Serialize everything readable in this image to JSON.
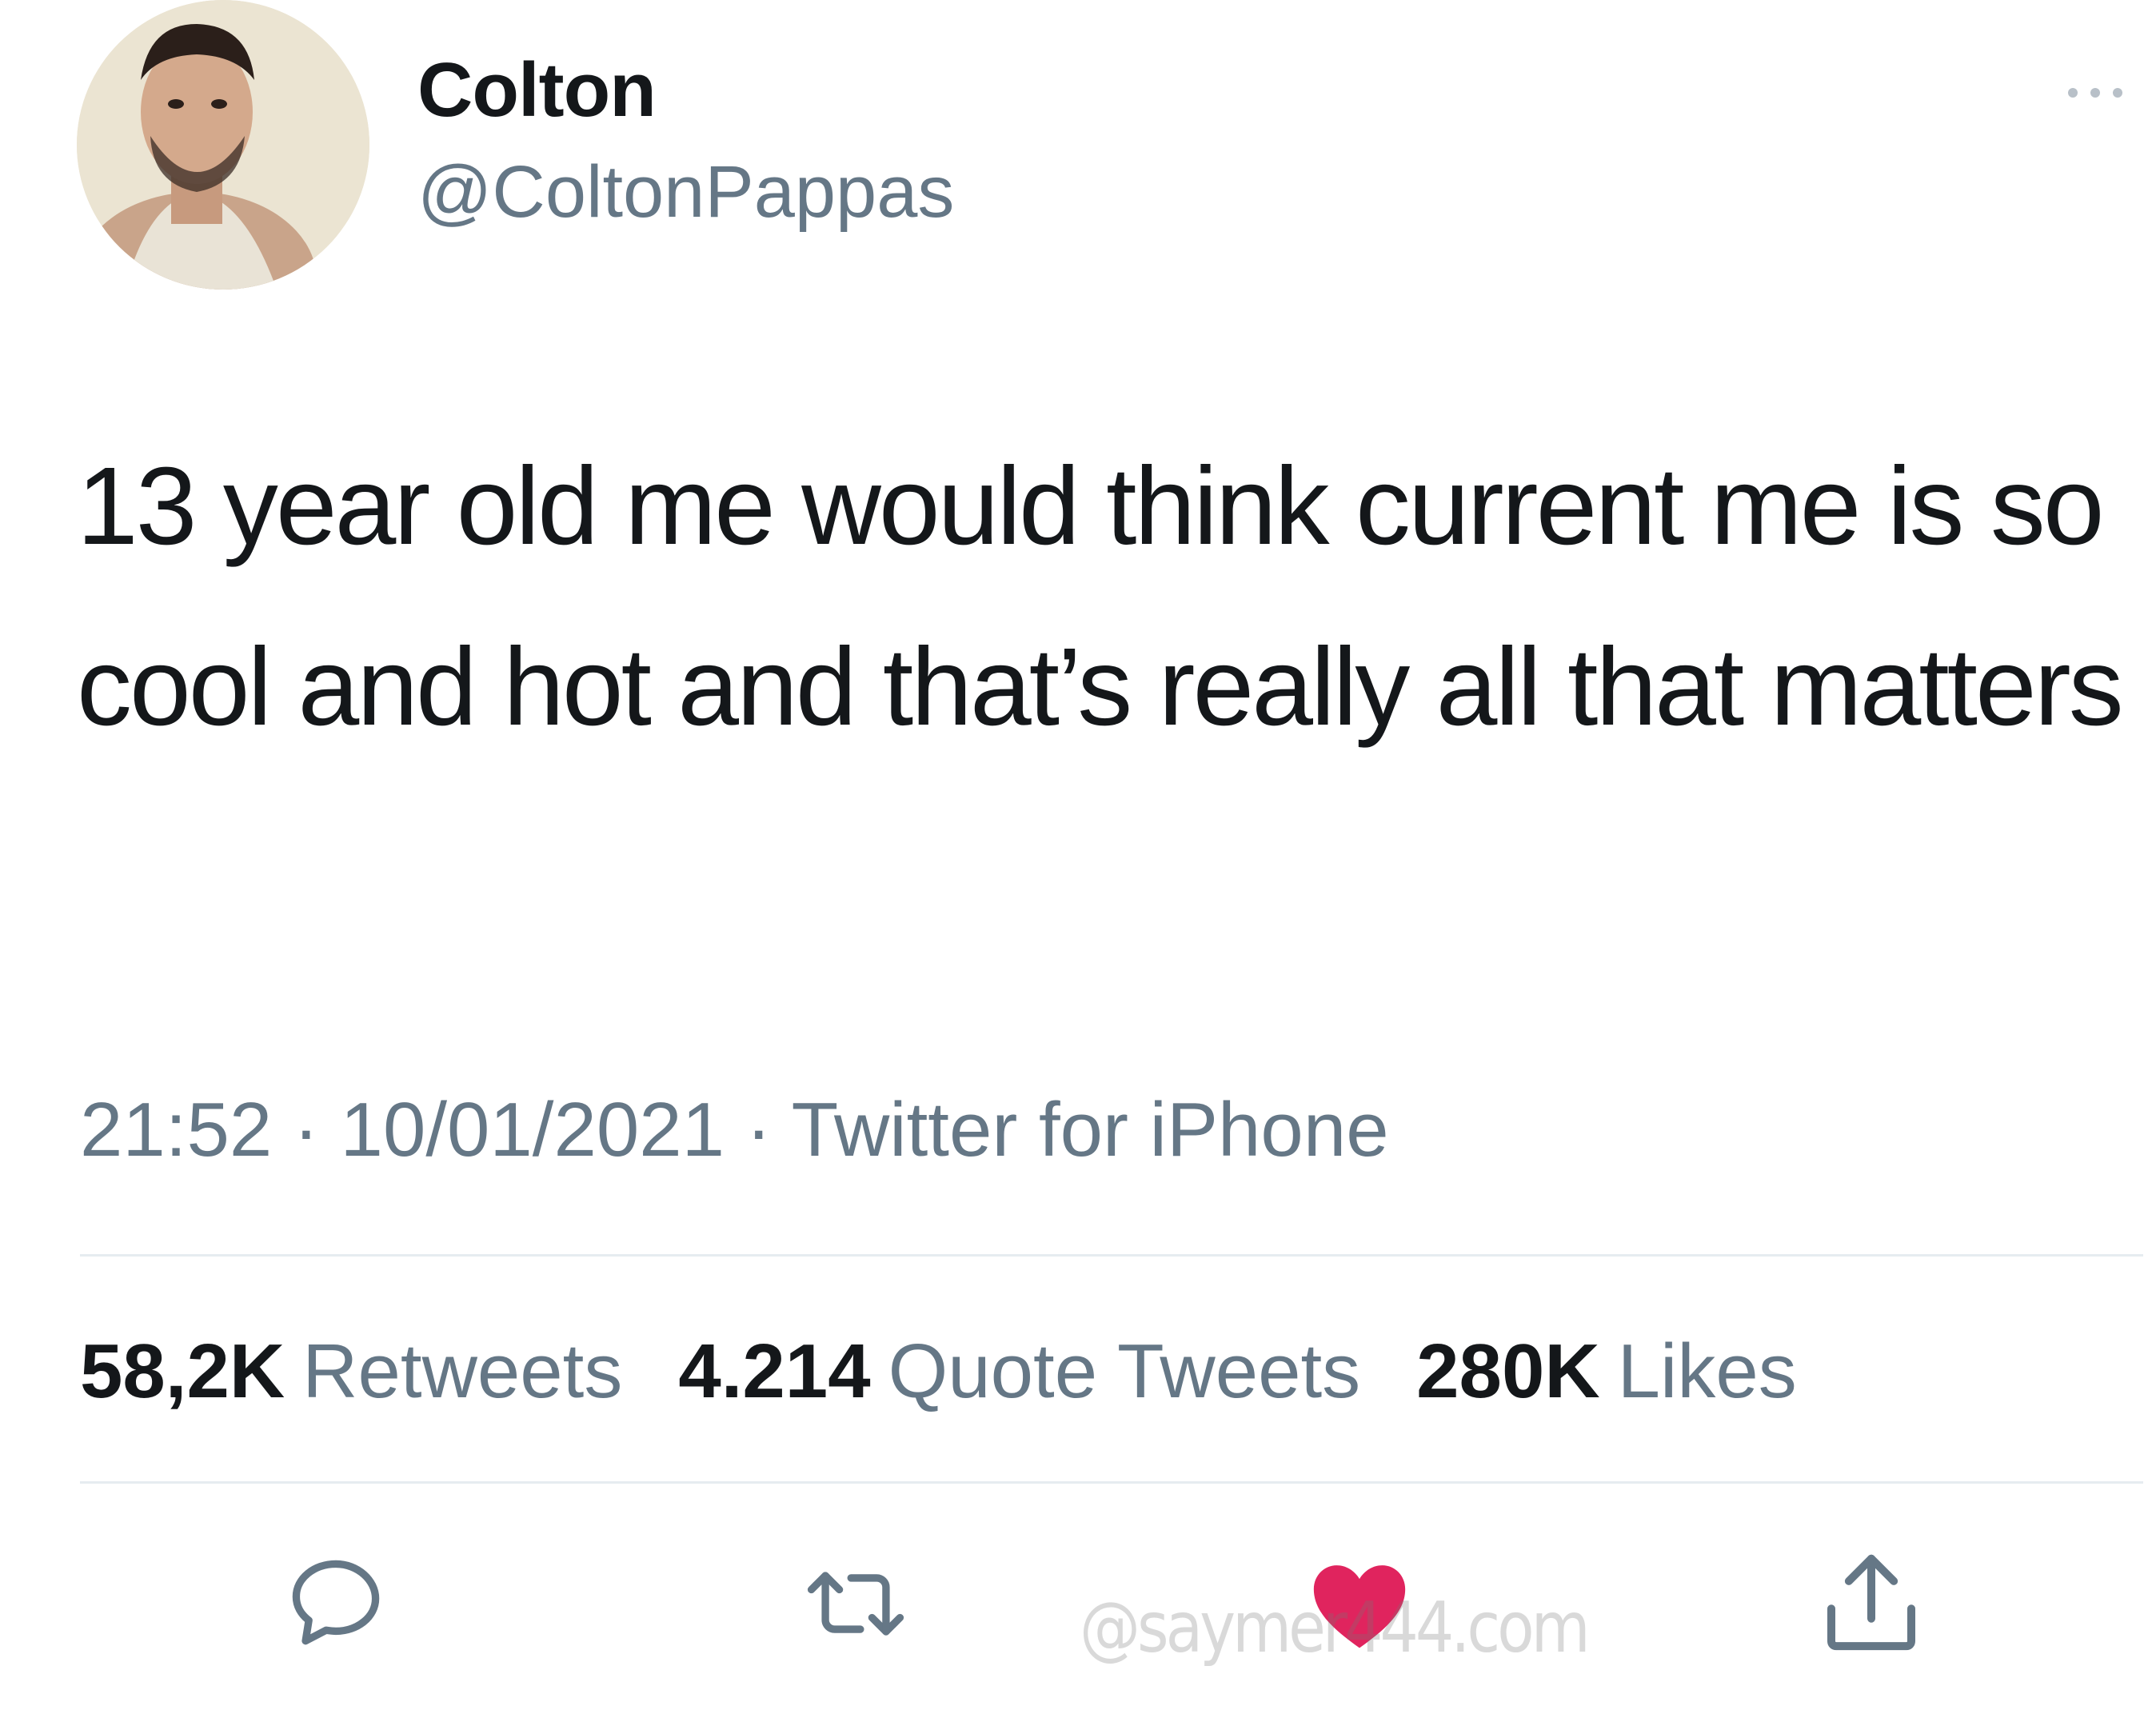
{
  "user": {
    "display_name": "Colton",
    "handle": "@ColtonPappas"
  },
  "tweet": {
    "text": "13 year old me would think current me is so cool and hot and that’s really all that matters",
    "time": "21:52",
    "date": "10/01/2021",
    "separator": "·",
    "source": "Twitter for iPhone"
  },
  "stats": {
    "retweets_count": "58,2K",
    "retweets_label": "Retweets",
    "quotes_count": "4.214",
    "quotes_label": "Quote Tweets",
    "likes_count": "280K",
    "likes_label": "Likes"
  },
  "actions": {
    "reply_icon": "speech-bubble-icon",
    "retweet_icon": "retweet-arrows-icon",
    "like_icon": "heart-icon",
    "share_icon": "share-upload-icon"
  },
  "watermark": "@saymer444.com",
  "colors": {
    "text_primary": "#14171a",
    "text_secondary": "#657786",
    "divider": "#e6ecf0",
    "like_red": "#e0245e",
    "icon_gray": "#657786"
  }
}
